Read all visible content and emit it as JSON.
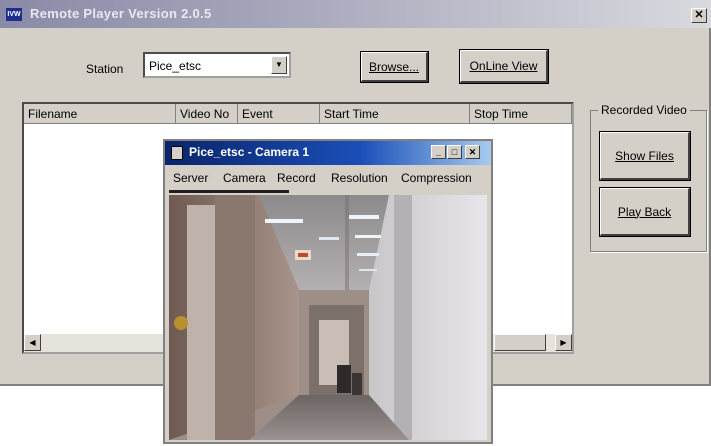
{
  "main_window": {
    "title": "Remote Player Version 2.0.5",
    "app_icon": "IVW",
    "close_glyph": "✕",
    "station_label": "Station",
    "station_value": "Pice_etsc",
    "browse_label": "Browse...",
    "online_view_label": "OnLine View",
    "list_columns": [
      "Filename",
      "Video No",
      "Event",
      "Start Time",
      "Stop Time"
    ],
    "recorded_group_title": "Recorded Video",
    "show_files_label": "Show Files",
    "play_back_label": "Play Back"
  },
  "camera_window": {
    "title": "Pice_etsc - Camera 1",
    "menu": [
      "Server",
      "Camera",
      "Record",
      "Resolution",
      "Compression"
    ]
  },
  "icons": [
    "app-icon",
    "close-icon",
    "dropdown-arrow-icon",
    "scroll-left-icon",
    "scroll-right-icon",
    "camera-window-icon",
    "minimize-icon",
    "maximize-icon"
  ]
}
